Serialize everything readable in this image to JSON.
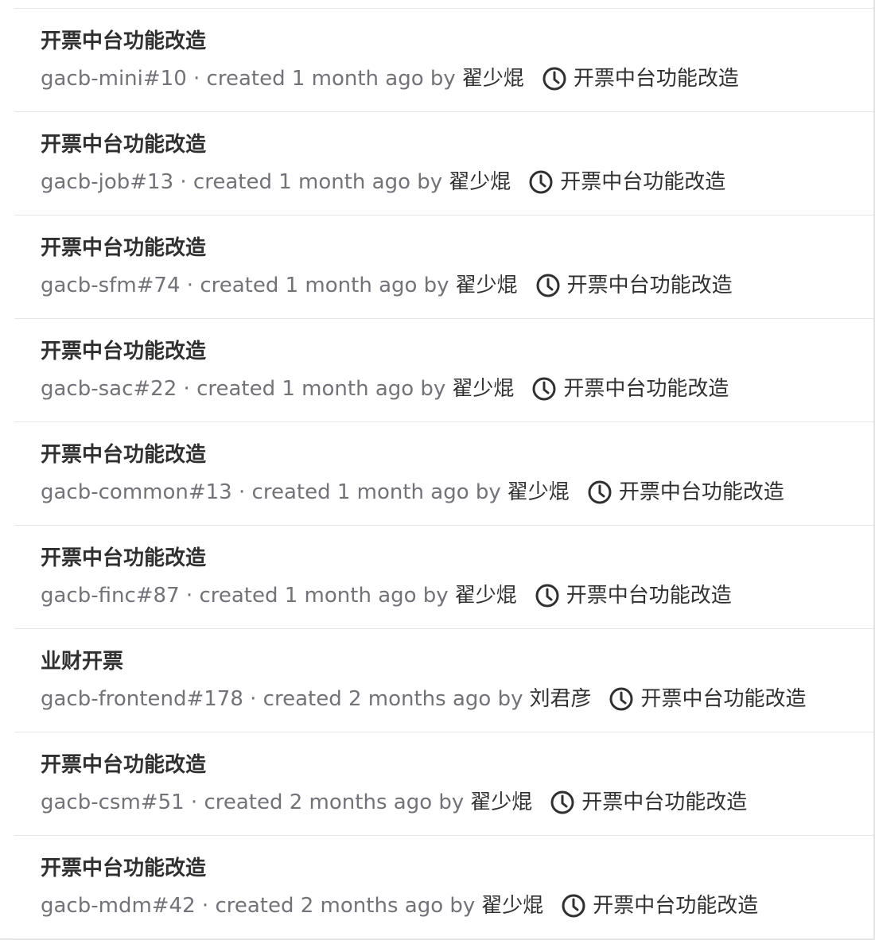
{
  "issues": [
    {
      "title": "开票中台功能改造",
      "ref": "gacb-mini#10",
      "created": "created 1 month ago by",
      "author": "翟少焜",
      "milestone": "开票中台功能改造",
      "icon": "clock-icon"
    },
    {
      "title": "开票中台功能改造",
      "ref": "gacb-job#13",
      "created": "created 1 month ago by",
      "author": "翟少焜",
      "milestone": "开票中台功能改造",
      "icon": "clock-icon"
    },
    {
      "title": "开票中台功能改造",
      "ref": "gacb-sfm#74",
      "created": "created 1 month ago by",
      "author": "翟少焜",
      "milestone": "开票中台功能改造",
      "icon": "clock-icon"
    },
    {
      "title": "开票中台功能改造",
      "ref": "gacb-sac#22",
      "created": "created 1 month ago by",
      "author": "翟少焜",
      "milestone": "开票中台功能改造",
      "icon": "clock-icon"
    },
    {
      "title": "开票中台功能改造",
      "ref": "gacb-common#13",
      "created": "created 1 month ago by",
      "author": "翟少焜",
      "milestone": "开票中台功能改造",
      "icon": "clock-icon"
    },
    {
      "title": "开票中台功能改造",
      "ref": "gacb-finc#87",
      "created": "created 1 month ago by",
      "author": "翟少焜",
      "milestone": "开票中台功能改造",
      "icon": "clock-icon"
    },
    {
      "title": "业财开票",
      "ref": "gacb-frontend#178",
      "created": "created 2 months ago by",
      "author": "刘君彦",
      "milestone": "开票中台功能改造",
      "icon": "clock-icon"
    },
    {
      "title": "开票中台功能改造",
      "ref": "gacb-csm#51",
      "created": "created 2 months ago by",
      "author": "翟少焜",
      "milestone": "开票中台功能改造",
      "icon": "clock-icon"
    },
    {
      "title": "开票中台功能改造",
      "ref": "gacb-mdm#42",
      "created": "created 2 months ago by",
      "author": "翟少焜",
      "milestone": "开票中台功能改造",
      "icon": "clock-icon"
    }
  ],
  "colors": {
    "title": "#303030",
    "meta": "#737278",
    "divider": "#e6e6e6"
  }
}
